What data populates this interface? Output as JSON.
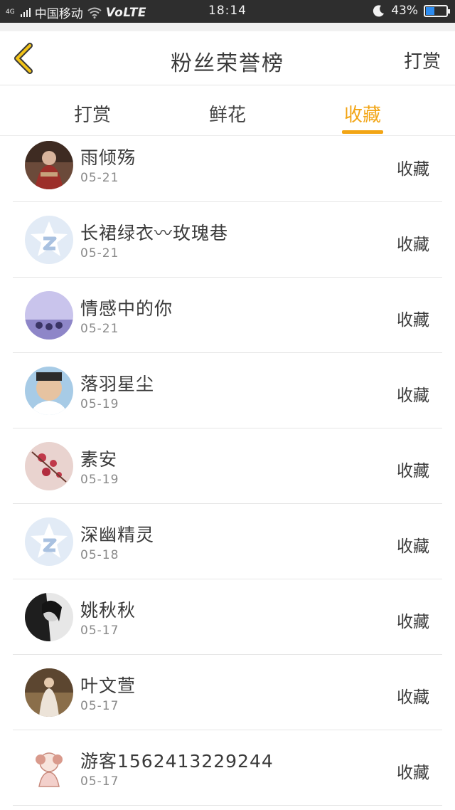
{
  "status_bar": {
    "carrier": "中国移动",
    "network": "VoLTE",
    "signal_label": "4G",
    "time": "18:14",
    "battery": "43%",
    "battery_level": 0.43,
    "icons": [
      "signal-icon",
      "wifi-icon",
      "moon-icon",
      "battery-icon"
    ]
  },
  "header": {
    "back_icon": "chevron-left-icon",
    "title": "粉丝荣誉榜",
    "action": "打赏",
    "back_color": "#f2a515"
  },
  "tabs": [
    {
      "label": "打赏",
      "active": false
    },
    {
      "label": "鲜花",
      "active": false
    },
    {
      "label": "收藏",
      "active": true
    }
  ],
  "accent_color": "#f2a515",
  "fans": [
    {
      "name": "雨倾殇",
      "date": "05-21",
      "action": "收藏",
      "avatar": "photo-avatar"
    },
    {
      "name": "长裙绿衣〰玫瑰巷",
      "date": "05-21",
      "action": "收藏",
      "avatar": "default-qq-avatar"
    },
    {
      "name": "情感中的你",
      "date": "05-21",
      "action": "收藏",
      "avatar": "photo-avatar"
    },
    {
      "name": "落羽星尘",
      "date": "05-19",
      "action": "收藏",
      "avatar": "photo-avatar"
    },
    {
      "name": "素安",
      "date": "05-19",
      "action": "收藏",
      "avatar": "photo-avatar"
    },
    {
      "name": "深幽精灵",
      "date": "05-18",
      "action": "收藏",
      "avatar": "default-qq-avatar"
    },
    {
      "name": "姚秋秋",
      "date": "05-17",
      "action": "收藏",
      "avatar": "photo-avatar"
    },
    {
      "name": "叶文萱",
      "date": "05-17",
      "action": "收藏",
      "avatar": "photo-avatar"
    },
    {
      "name": "游客15624132​29244",
      "date": "05-17",
      "action": "收藏",
      "avatar": "cartoon-avatar"
    }
  ]
}
